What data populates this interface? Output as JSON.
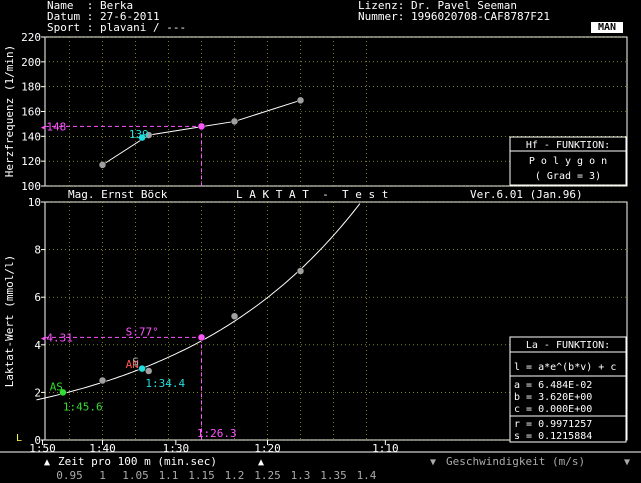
{
  "header": {
    "name_label": "Name",
    "name_value": "Berka",
    "date_label": "Datum",
    "date_value": "27-6-2011",
    "sport_label": "Sport",
    "sport_value": "plavani / ---",
    "license_label": "Lizenz:",
    "license_value": "Dr. Pavel Seeman",
    "number_label": "Nummer:",
    "number_value": "1996020708-CAF8787F21",
    "mode_badge": "MAN"
  },
  "banner": {
    "author": "Mag. Ernst Böck",
    "title": "L A K T A T  -  T e s t",
    "version": "Ver.6.01 (Jan.96)"
  },
  "hf_box": {
    "title": "Hf - FUNKTION:",
    "type": "P o l y g o n",
    "grade": "( Grad = 3)"
  },
  "la_box": {
    "title": "La - FUNKTION:",
    "formula": "l = a*e^(b*v) + c",
    "a": "a = 6.484E-02",
    "b": "b = 3.620E+00",
    "c": "c = 0.000E+00",
    "r": "r = 0.9971257",
    "s": "s = 0.1215884"
  },
  "bottom": {
    "time_axis_label": "Zeit pro 100 m (min.sec)",
    "speed_axis_label": "Geschwindigkeit (m/s)",
    "time_ticks": [
      "1:50",
      "1:40",
      "1:30",
      "1:20",
      "1:10"
    ],
    "speed_ticks": [
      "0.95",
      "1",
      "1.05",
      "1.1",
      "1.15",
      "1.2",
      "1.25",
      "1.3",
      "1.35",
      "1.4"
    ],
    "corner_label": "L"
  },
  "chart_data": [
    {
      "type": "line",
      "ylabel": "Herzfrequenz (1/min)",
      "ylim": [
        100,
        220
      ],
      "yticks": [
        100,
        120,
        140,
        160,
        180,
        200,
        220
      ],
      "xlim": [
        0.9,
        1.4
      ],
      "points": [
        {
          "x": 1.0,
          "y": 117,
          "color": "#a0a0a0"
        },
        {
          "x": 1.06,
          "y": 139,
          "color": "#22dddd"
        },
        {
          "x": 1.07,
          "y": 141,
          "color": "#a0a0a0"
        },
        {
          "x": 1.15,
          "y": 148,
          "color": "#ff55ff"
        },
        {
          "x": 1.2,
          "y": 152,
          "color": "#a0a0a0"
        },
        {
          "x": 1.3,
          "y": 169,
          "color": "#a0a0a0"
        }
      ],
      "labels": [
        {
          "text": "◂148",
          "x": 0.905,
          "y": 148,
          "color": "#ff55ff"
        },
        {
          "text": "139",
          "x": 1.04,
          "y": 142,
          "color": "#22dddd"
        }
      ],
      "grid": true
    },
    {
      "type": "line",
      "ylabel": "Laktat-Wert (mmol/l)",
      "ylim": [
        0,
        10
      ],
      "yticks": [
        0,
        2,
        4,
        6,
        8,
        10
      ],
      "xlim": [
        0.9,
        1.4
      ],
      "points": [
        {
          "x": 0.94,
          "y": 2.0,
          "color": "#33dd33"
        },
        {
          "x": 1.0,
          "y": 2.5,
          "color": "#a0a0a0"
        },
        {
          "x": 1.06,
          "y": 3.0,
          "color": "#22dddd"
        },
        {
          "x": 1.07,
          "y": 2.9,
          "color": "#a0a0a0"
        },
        {
          "x": 1.15,
          "y": 4.31,
          "color": "#ff55ff"
        },
        {
          "x": 1.2,
          "y": 5.2,
          "color": "#a0a0a0"
        },
        {
          "x": 1.3,
          "y": 7.1,
          "color": "#a0a0a0"
        }
      ],
      "labels": [
        {
          "text": "AS",
          "x": 0.92,
          "y": 2.25,
          "color": "#33dd33"
        },
        {
          "text": "1:45.6",
          "x": 0.94,
          "y": 1.4,
          "color": "#33dd33"
        },
        {
          "text": "◂4.31",
          "x": 0.905,
          "y": 4.31,
          "color": "#ff55ff"
        },
        {
          "text": "S:77°",
          "x": 1.035,
          "y": 4.55,
          "color": "#ff55ff"
        },
        {
          "text": "AN",
          "x": 1.035,
          "y": 3.2,
          "color": "#ff5555"
        },
        {
          "text": "S",
          "x": 1.045,
          "y": 3.3,
          "color": "#aaaaaa"
        },
        {
          "text": "1:34.4",
          "x": 1.065,
          "y": 2.4,
          "color": "#22dddd"
        },
        {
          "text": "1:26.3",
          "x": 1.143,
          "y": 0.3,
          "color": "#ff55ff"
        }
      ],
      "grid": true
    }
  ]
}
